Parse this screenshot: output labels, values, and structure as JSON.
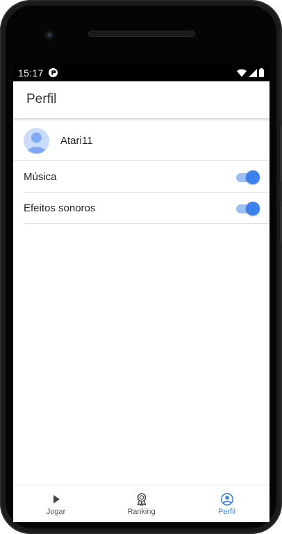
{
  "status_bar": {
    "time": "15:17",
    "app_icon": "notification-app-icon",
    "icons": [
      "wifi-icon",
      "cellular-signal-icon",
      "battery-icon"
    ]
  },
  "app_bar": {
    "title": "Perfil"
  },
  "profile": {
    "avatar_icon": "person-avatar-icon",
    "username": "Atari11"
  },
  "settings": [
    {
      "label": "Música",
      "enabled": true
    },
    {
      "label": "Efeitos sonoros",
      "enabled": true
    }
  ],
  "bottom_nav": {
    "items": [
      {
        "label": "Jogar",
        "icon": "play-icon",
        "active": false
      },
      {
        "label": "Ranking",
        "icon": "award-ribbon-icon",
        "active": false
      },
      {
        "label": "Perfil",
        "icon": "account-circle-icon",
        "active": true
      }
    ]
  },
  "colors": {
    "accent": "#3b82f0",
    "toggle_track": "#9dbff5",
    "avatar_bg": "#c9dcfb",
    "inactive_text": "#555555"
  }
}
